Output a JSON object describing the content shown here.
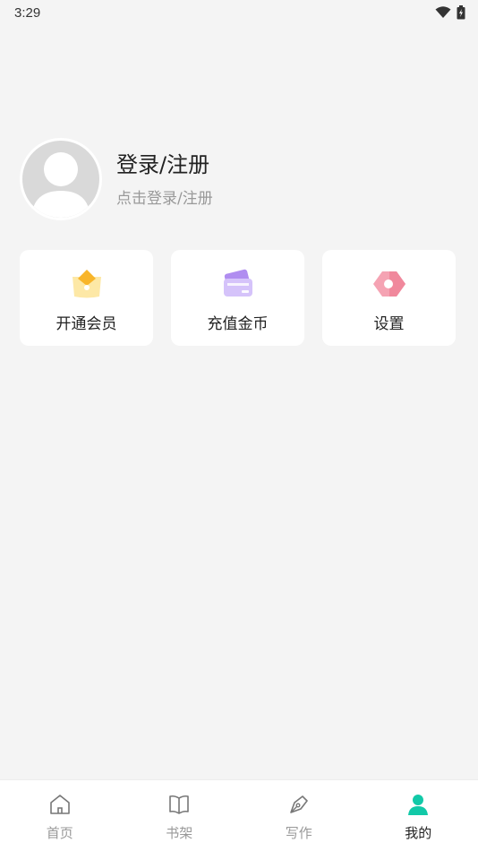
{
  "status_bar": {
    "time": "3:29",
    "icons": [
      "wifi-icon",
      "battery-charging-icon"
    ]
  },
  "profile": {
    "title": "登录/注册",
    "subtitle": "点击登录/注册",
    "avatar_icon": "default-avatar-icon"
  },
  "quick_actions": [
    {
      "label": "开通会员",
      "icon": "vip-crown-icon"
    },
    {
      "label": "充值金币",
      "icon": "recharge-card-icon"
    },
    {
      "label": "设置",
      "icon": "settings-icon"
    }
  ],
  "tabbar": {
    "items": [
      {
        "label": "首页",
        "icon": "home-icon"
      },
      {
        "label": "书架",
        "icon": "bookshelf-icon"
      },
      {
        "label": "写作",
        "icon": "write-pen-icon"
      },
      {
        "label": "我的",
        "icon": "profile-icon",
        "active": true
      }
    ],
    "accent": "#12c9a8"
  },
  "colors": {
    "background": "#f4f4f4",
    "card": "#ffffff",
    "muted_text": "#999999"
  }
}
